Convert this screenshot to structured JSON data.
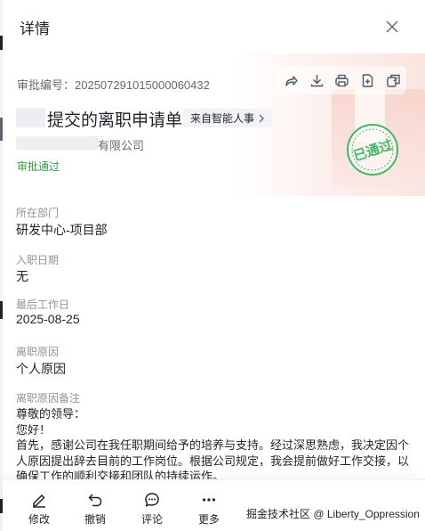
{
  "header": {
    "title": "详情",
    "close_icon": "close-icon"
  },
  "approval": {
    "number_label": "审批编号：",
    "number": "202507291015000060432",
    "title": "提交的离职申请单",
    "source_tag": "来自智能人事",
    "company_suffix": "有限公司",
    "status": "审批通过",
    "stamp_text": "已通过",
    "stamp_color": "#3fb86b",
    "status_color": "#2ea043"
  },
  "toolbar": {
    "icons": [
      "share-icon",
      "download-icon",
      "print-icon",
      "export-icon",
      "copy-icon"
    ]
  },
  "fields": {
    "department_label": "所在部门",
    "department": "研发中心-项目部",
    "join_date_label": "入职日期",
    "join_date": "无",
    "last_day_label": "最后工作日",
    "last_day": "2025-08-25",
    "reason_label": "离职原因",
    "reason": "个人原因",
    "note_label": "离职原因备注",
    "note_lines": [
      "尊敬的领导：",
      "您好！",
      "首先，感谢公司在我任职期间给予的培养与支持。经过深思熟虑，我决定因个人原因提出辞去目前的工作岗位。根据公司规定，我会提前做好工作交接，以确保工作的顺利交接和团队的持续运作。"
    ]
  },
  "actions": {
    "edit": "修改",
    "revoke": "撤销",
    "comment": "评论",
    "more": "更多"
  },
  "watermark": "掘金技术社区 @ Liberty_Oppression"
}
